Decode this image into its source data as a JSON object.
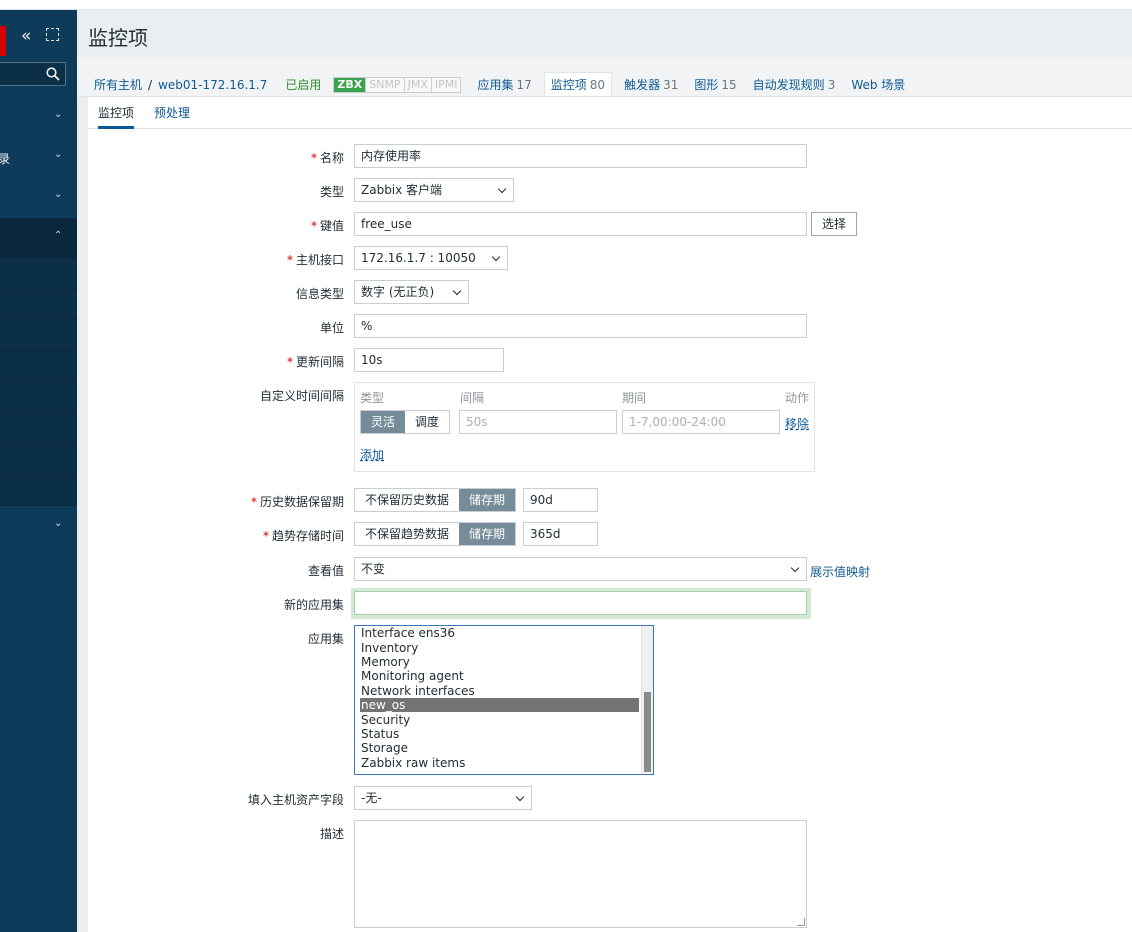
{
  "sidebar": {
    "items": [
      {
        "label": "",
        "chevron": "⌄"
      },
      {
        "label": "录",
        "chevron": "⌄"
      },
      {
        "label": "",
        "chevron": "⌄"
      },
      {
        "label": "",
        "chevron": "⌃"
      },
      {
        "label": "",
        "chevron": "⌄"
      }
    ]
  },
  "page": {
    "title": "监控项"
  },
  "breadcrumb": {
    "all_hosts": "所有主机",
    "separator": "/",
    "host": "web01-172.16.1.7",
    "status": "已启用",
    "availability": [
      "ZBX",
      "SNMP",
      "JMX",
      "IPMI"
    ],
    "links": [
      {
        "label": "应用集",
        "count": "17"
      },
      {
        "label": "监控项",
        "count": "80"
      },
      {
        "label": "触发器",
        "count": "31"
      },
      {
        "label": "图形",
        "count": "15"
      },
      {
        "label": "自动发现规则",
        "count": "3"
      },
      {
        "label": "Web 场景",
        "count": ""
      }
    ]
  },
  "tabs": {
    "item": "监控项",
    "preprocessing": "预处理"
  },
  "form": {
    "name": {
      "label": "名称",
      "value": "内存使用率"
    },
    "type": {
      "label": "类型",
      "value": "Zabbix 客户端"
    },
    "key": {
      "label": "键值",
      "value": "free_use",
      "button": "选择"
    },
    "interface": {
      "label": "主机接口",
      "value": "172.16.1.7 : 10050"
    },
    "info_type": {
      "label": "信息类型",
      "value": "数字 (无正负)"
    },
    "units": {
      "label": "单位",
      "value": "%"
    },
    "update_interval": {
      "label": "更新间隔",
      "value": "10s"
    },
    "custom_intervals": {
      "label": "自定义时间间隔",
      "headers": {
        "type": "类型",
        "interval": "间隔",
        "period": "期间",
        "action": "动作"
      },
      "type_options": [
        "灵活",
        "调度"
      ],
      "interval_placeholder": "50s",
      "period_placeholder": "1-7,00:00-24:00",
      "remove": "移除",
      "add": "添加"
    },
    "history": {
      "label": "历史数据保留期",
      "options": [
        "不保留历史数据",
        "储存期"
      ],
      "value": "90d"
    },
    "trends": {
      "label": "趋势存储时间",
      "options": [
        "不保留趋势数据",
        "储存期"
      ],
      "value": "365d"
    },
    "show_value": {
      "label": "查看值",
      "value": "不变",
      "link": "展示值映射"
    },
    "new_application": {
      "label": "新的应用集",
      "value": ""
    },
    "applications": {
      "label": "应用集",
      "options": [
        "Interface ens36",
        "Inventory",
        "Memory",
        "Monitoring agent",
        "Network interfaces",
        "new_os",
        "Security",
        "Status",
        "Storage",
        "Zabbix raw items"
      ],
      "selected": "new_os"
    },
    "inventory": {
      "label": "填入主机资产字段",
      "value": "-无-"
    },
    "description": {
      "label": "描述",
      "value": ""
    }
  },
  "colors": {
    "sidebar": "#0e3b5a",
    "link": "#0d5a95",
    "zbx_green": "#3aa34d",
    "required": "#d40000"
  }
}
